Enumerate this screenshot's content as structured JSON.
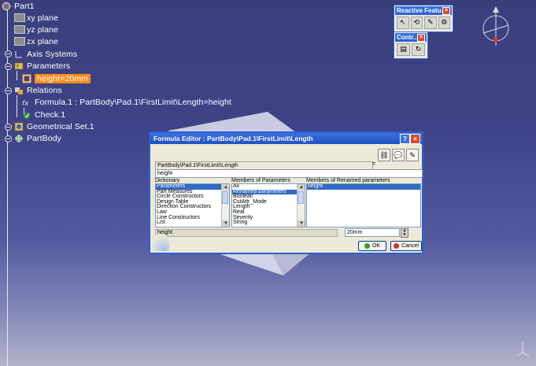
{
  "tree": {
    "root": "Part1",
    "xy_plane": "xy plane",
    "yz_plane": "yz plane",
    "zx_plane": "zx plane",
    "axis_systems": "Axis Systems",
    "parameters": "Parameters",
    "height_param": "height=20mm",
    "relations": "Relations",
    "formula": "Formula.1 : PartBody\\Pad.1\\FirstLimit\\Length=height",
    "check": "Check.1",
    "geometrical_set": "Geometrical Set.1",
    "partbody": "PartBody"
  },
  "reactive_toolbar": {
    "title": "Reactive Featu..."
  },
  "contr_toolbar": {
    "title": "Contr..."
  },
  "dialog": {
    "title": "Formula Editor : PartBody\\Pad.1\\FirstLimit\\Length",
    "path": "PartBody\\Pad.1\\FirstLimit\\Length",
    "equals": "=",
    "formula_value": "height",
    "dictionary_label": "Dictionary",
    "dictionary_items": [
      "Parameters",
      "Part Measures",
      "Circle Constructors",
      "Design Table",
      "Direction Constructors",
      "Law",
      "Line Constructors",
      "List"
    ],
    "members_label": "Members of Parameters",
    "members_items": [
      "All",
      "Renamed parameters",
      "Boolean",
      "CstAttr_Mode",
      "Length",
      "Real",
      "Severity",
      "String"
    ],
    "renamed_label": "Members of Renamed parameters",
    "renamed_items": [
      "height"
    ],
    "status_text": "height",
    "value": "20mm",
    "ok_label": "OK",
    "cancel_label": "Cancel"
  },
  "colors": {
    "selection_orange": "#ff8c1a",
    "title_blue": "#2b5fd0",
    "list_selection": "#316ac5"
  }
}
